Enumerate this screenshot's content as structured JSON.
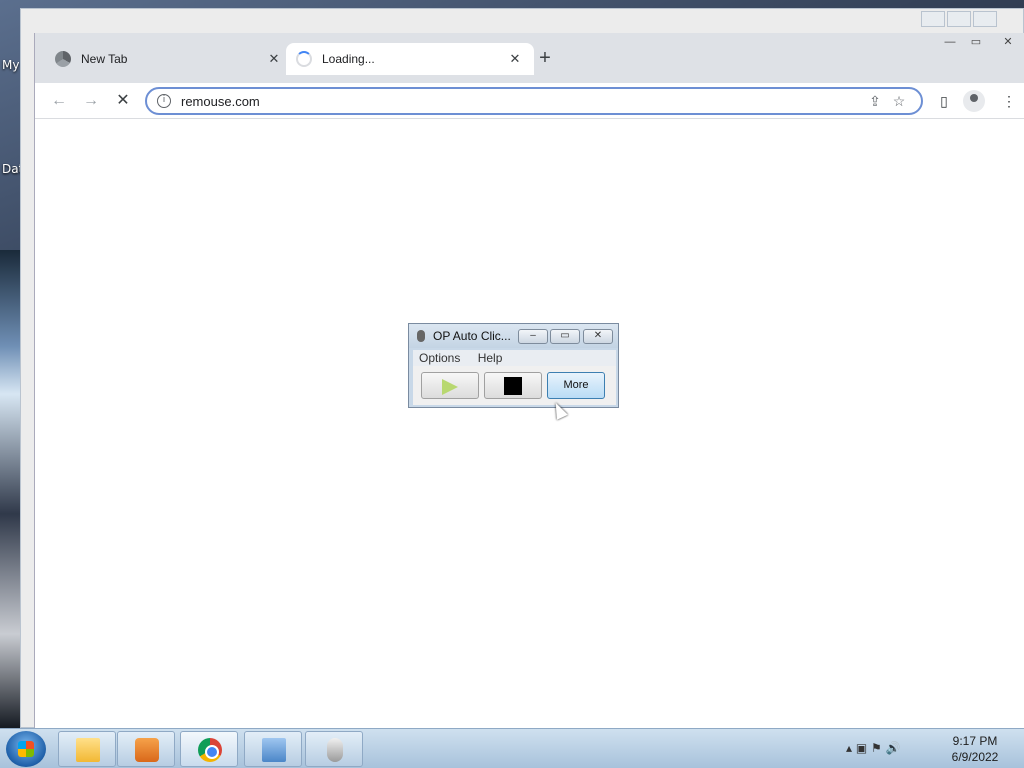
{
  "desktop": {
    "label_top": "My",
    "label_bottom": "Dat"
  },
  "browser": {
    "tabs": [
      {
        "title": "New Tab",
        "close": "✕"
      },
      {
        "title": "Loading...",
        "close": "✕"
      }
    ],
    "new_tab_icon": "+",
    "nav": {
      "back": "←",
      "forward": "→",
      "stop": "✕"
    },
    "url": "remouse.com",
    "info_icon": "i",
    "share_icon": "⇪",
    "star_icon": "☆",
    "side_panel_icon": "▯",
    "menu_icon": "⋮",
    "window": {
      "minimize": "—",
      "maximize": "▭",
      "close": "✕"
    }
  },
  "clicker": {
    "title": "OP Auto Clic...",
    "menu": [
      "Options",
      "Help"
    ],
    "buttons": {
      "more": "More"
    },
    "window": {
      "minimize": "–",
      "restore": "▭",
      "close": "✕"
    }
  },
  "taskbar": {
    "tray_icons": "▴  ▣  ⚑  🔊",
    "time": "9:17 PM",
    "date": "6/9/2022"
  },
  "colors": {
    "omnibox_border": "#6d8fd4",
    "play_green": "#b8d870",
    "more_blue": "#b9dcf5"
  }
}
